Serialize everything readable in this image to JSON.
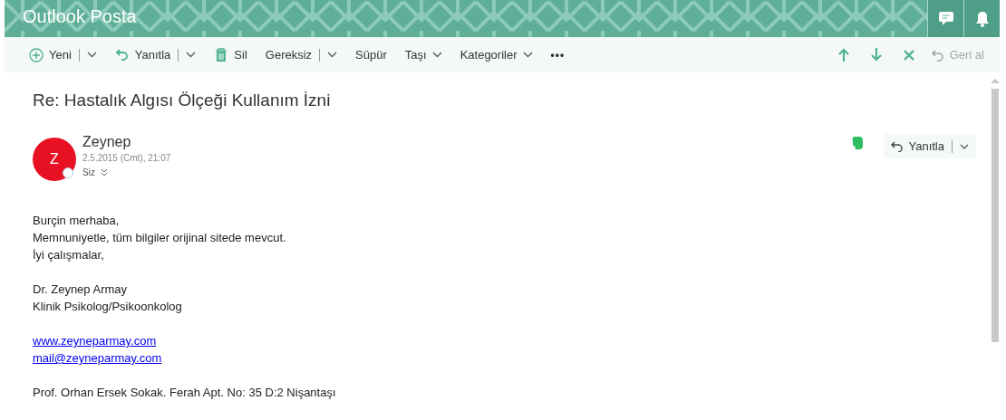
{
  "header": {
    "title": "Outlook Posta"
  },
  "toolbar": {
    "actions": [
      {
        "label": "Yeni",
        "kind": "split"
      },
      {
        "label": "Yanıtla",
        "kind": "split"
      },
      {
        "label": "Sil",
        "kind": "plain"
      },
      {
        "label": "Gereksiz",
        "kind": "split"
      },
      {
        "label": "Süpür",
        "kind": "plain"
      },
      {
        "label": "Taşı",
        "kind": "menu"
      },
      {
        "label": "Kategoriler",
        "kind": "menu"
      },
      {
        "label": "•••",
        "kind": "more"
      }
    ],
    "undo": {
      "label": "Geri al",
      "disabled": true
    }
  },
  "message": {
    "subject": "Re: Hastalık Algısı Ölçeği Kullanım İzni",
    "sender": {
      "initial": "Z",
      "name": "Zeynep",
      "date": "2.5.2015 (Cmt), 21:07",
      "recipients": "Siz"
    },
    "reply_button": {
      "label": "Yanıtla"
    },
    "body": [
      {
        "kind": "text",
        "text": "Burçin merhaba,"
      },
      {
        "kind": "text",
        "text": "Memnuniyetle, tüm bilgiler orijinal sitede mevcut."
      },
      {
        "kind": "text",
        "text": "İyi çalışmalar,"
      },
      {
        "kind": "gap"
      },
      {
        "kind": "text",
        "text": "Dr. Zeynep Armay"
      },
      {
        "kind": "text",
        "text": "Klinik Psikolog/Psikoonkolog"
      },
      {
        "kind": "gap"
      },
      {
        "kind": "link",
        "text": "www.zeyneparmay.com"
      },
      {
        "kind": "link",
        "text": "mail@zeyneparmay.com"
      },
      {
        "kind": "gap"
      },
      {
        "kind": "text",
        "text": "Prof. Orhan Ersek Sokak. Ferah Apt. No: 35 D:2 Nişantaşı"
      }
    ]
  }
}
